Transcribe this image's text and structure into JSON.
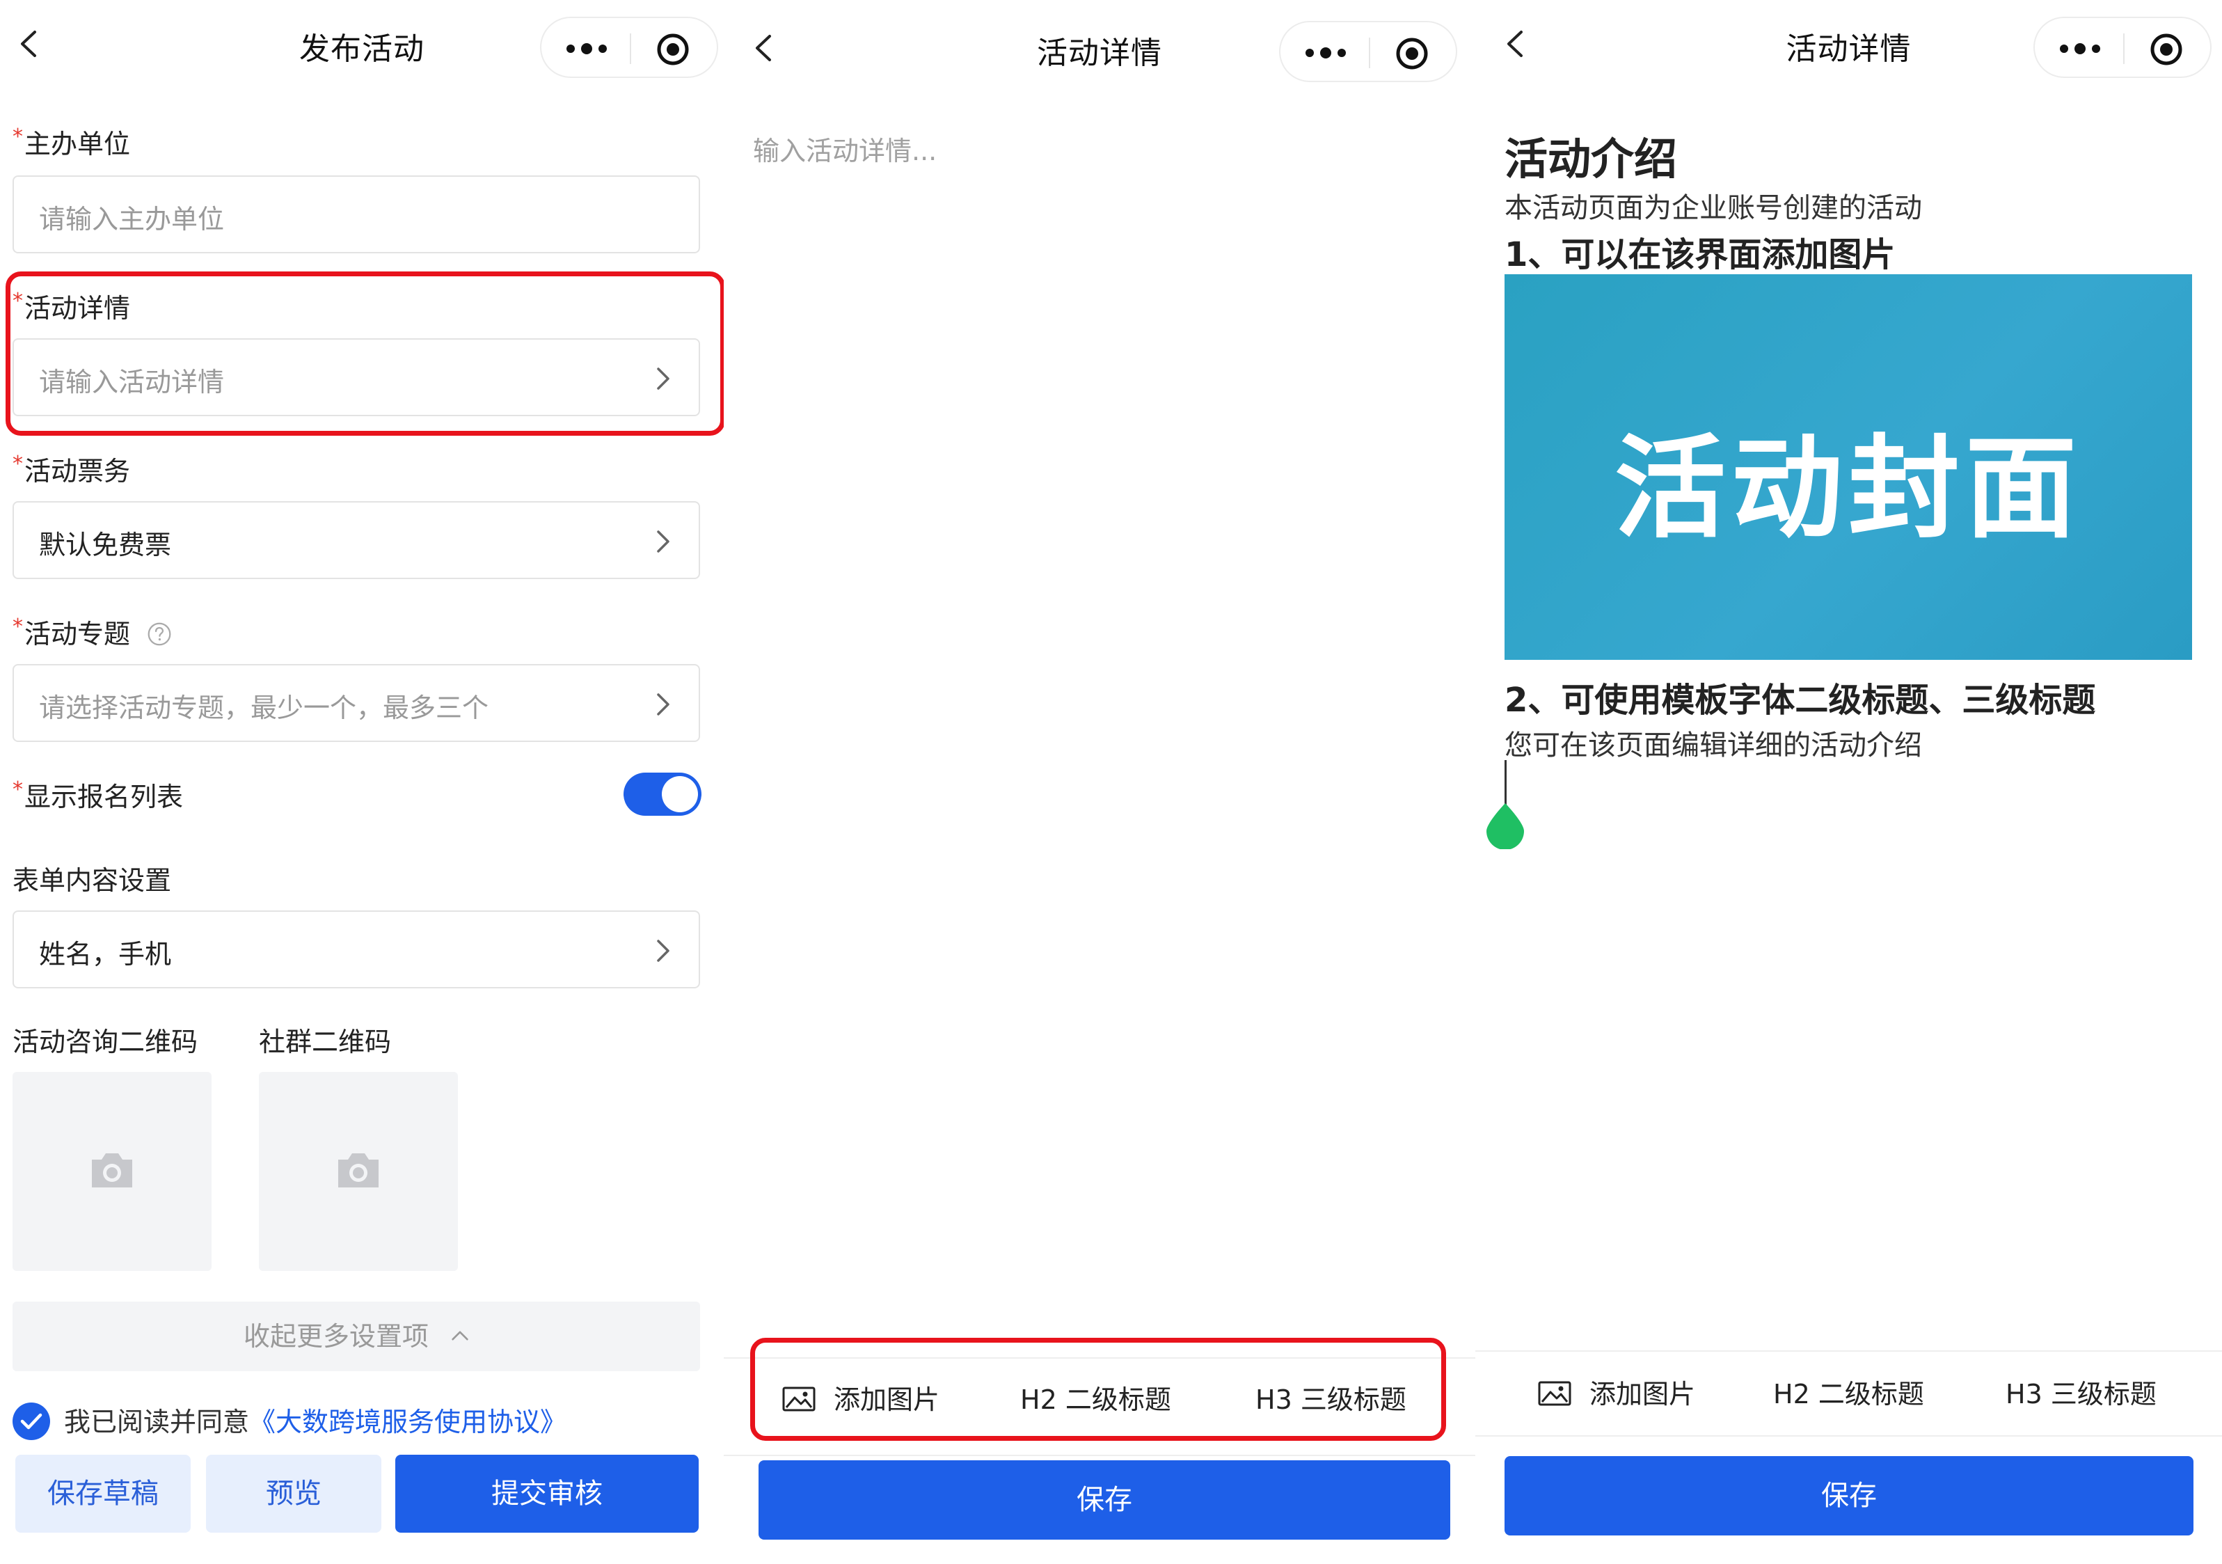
{
  "screen1": {
    "nav": {
      "title": "发布活动"
    },
    "required_mark": "*",
    "fields": {
      "organizer": {
        "label": "主办单位",
        "placeholder": "请输入主办单位"
      },
      "details": {
        "label": "活动详情",
        "placeholder": "请输入活动详情"
      },
      "ticket": {
        "label": "活动票务",
        "value": "默认免费票"
      },
      "topic": {
        "label": "活动专题",
        "placeholder": "请选择活动专题，最少一个，最多三个"
      },
      "show_signup": {
        "label": "显示报名列表",
        "enabled": true
      },
      "form_settings": {
        "label": "表单内容设置",
        "value": "姓名，手机"
      }
    },
    "qr": {
      "consult_label": "活动咨询二维码",
      "community_label": "社群二维码"
    },
    "collapse_label": "收起更多设置项",
    "agreement": {
      "prefix": "我已阅读并同意",
      "link": "《大数跨境服务使用协议》",
      "checked": true
    },
    "buttons": {
      "save_draft": "保存草稿",
      "preview": "预览",
      "submit": "提交审核"
    }
  },
  "screen2": {
    "nav": {
      "title": "活动详情"
    },
    "editor_placeholder": "输入活动详情...",
    "toolbar": {
      "add_image": "添加图片",
      "h2": "H2 二级标题",
      "h3": "H3 三级标题"
    },
    "save": "保存"
  },
  "screen3": {
    "nav": {
      "title": "活动详情"
    },
    "content": {
      "heading": "活动介绍",
      "intro": "本活动页面为企业账号创建的活动",
      "point1": "1、可以在该界面添加图片",
      "cover_text": "活动封面",
      "point2": "2、可使用模板字体二级标题、三级标题",
      "detail": "您可在该页面编辑详细的活动介绍"
    },
    "toolbar": {
      "add_image": "添加图片",
      "h2": "H2 二级标题",
      "h3": "H3 三级标题"
    },
    "save": "保存"
  },
  "colors": {
    "primary": "#1e5fe8",
    "highlight": "#e8131c",
    "cover": "#36a7cf",
    "cursor": "#1fbf63"
  }
}
